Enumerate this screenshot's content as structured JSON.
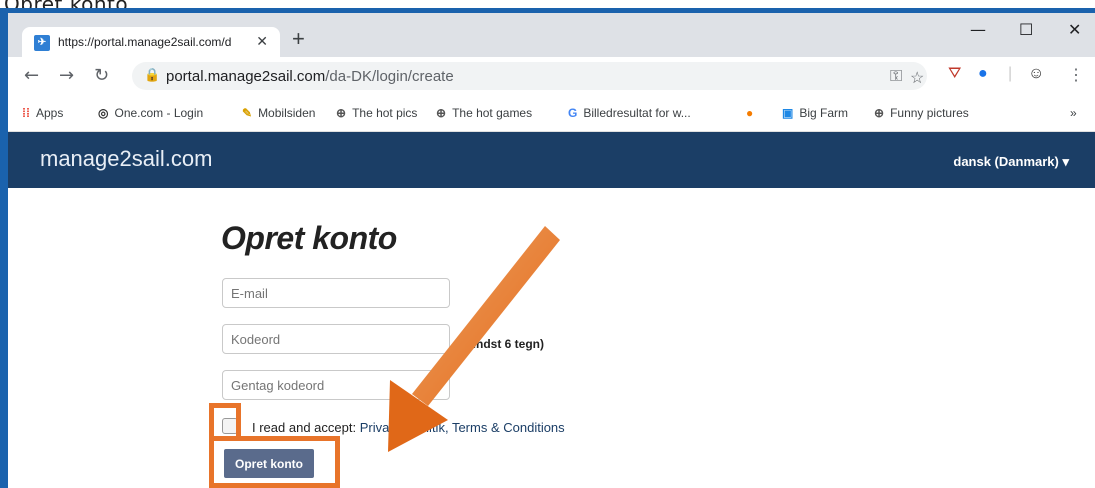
{
  "caption": "Opret konto",
  "browser": {
    "tab_title": "https://portal.manage2sail.com/d",
    "tab_favicon": "m2s",
    "tab_close": "✕",
    "new_tab": "+",
    "window_minimize": "—",
    "window_maximize": "☐",
    "window_close": "✕",
    "url_domain": "portal.manage2sail.com",
    "url_path": "/da-DK/login/create"
  },
  "bookmarks": [
    {
      "label": "Apps",
      "icon": "apps-grid-icon"
    },
    {
      "label": "One.com - Login",
      "icon": "onecom-icon"
    },
    {
      "label": "Mobilsiden",
      "icon": "mobilsiden-icon"
    },
    {
      "label": "The hot pics",
      "icon": "globe-icon"
    },
    {
      "label": "The hot games",
      "icon": "globe-icon"
    },
    {
      "label": "Billedresultat for w...",
      "icon": "google-icon"
    },
    {
      "label": "Big Farm",
      "icon": "bigfarm-icon"
    },
    {
      "label": "Funny pictures",
      "icon": "globe-icon"
    }
  ],
  "site": {
    "brand": "manage2sail.com",
    "language": "dansk (Danmark) ▾"
  },
  "form": {
    "title": "Opret konto",
    "email_placeholder": "E-mail",
    "password_placeholder": "Kodeord",
    "password_hint": "(mindst 6 tegn)",
    "password_repeat_placeholder": "Gentag kodeord",
    "accept_prefix": "I read and accept:",
    "privacy_link": "Privatlivspolitik,",
    "terms_link": "Terms & Conditions",
    "submit_label": "Opret konto"
  },
  "colors": {
    "header_bg": "#1b3e66",
    "highlight": "#e8742a",
    "submit_bg": "#5a6b8c"
  }
}
